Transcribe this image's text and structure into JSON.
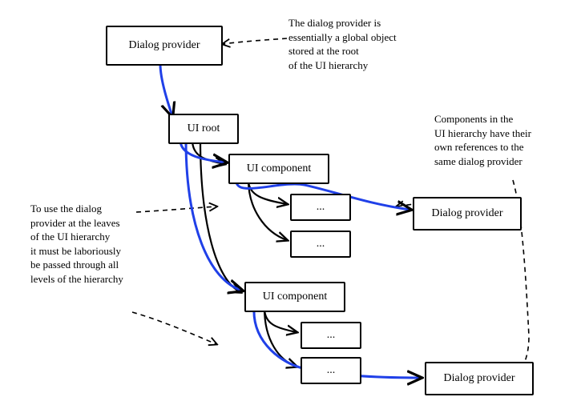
{
  "boxes": {
    "dialog_provider_top": "Dialog provider",
    "ui_root": "UI root",
    "ui_component_1": "UI component",
    "ui_component_2": "UI component",
    "leaf_a": "...",
    "leaf_b": "...",
    "leaf_c": "...",
    "leaf_d": "...",
    "dialog_provider_right1": "Dialog provider",
    "dialog_provider_right2": "Dialog provider"
  },
  "notes": {
    "top_right": "The dialog provider is\nessentially a global object\nstored at the root\nof the UI hierarchy",
    "right_mid": "Components in the\nUI hierarchy have their\nown references to the\nsame dialog provider",
    "left": "To use the dialog\nprovider at the leaves\nof the UI hierarchy\nit must be laboriously\nbe passed through all\nlevels of the hierarchy"
  }
}
